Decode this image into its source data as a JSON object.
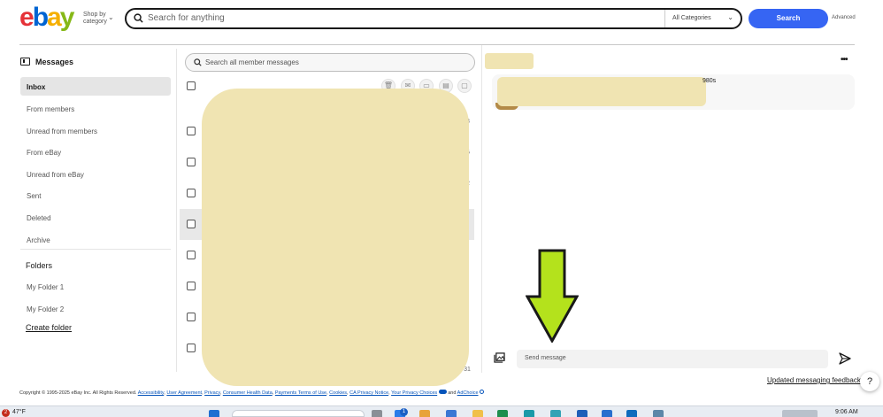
{
  "header": {
    "logo": {
      "e": "e",
      "b": "b",
      "a": "a",
      "y": "y"
    },
    "shop_by_line1": "Shop by",
    "shop_by_line2": "category",
    "search_placeholder": "Search for anything",
    "category_select": "All Categories",
    "search_button": "Search",
    "advanced": "Advanced"
  },
  "sidebar": {
    "title": "Messages",
    "items": [
      {
        "label": "Inbox",
        "active": true
      },
      {
        "label": "From members"
      },
      {
        "label": "Unread from members"
      },
      {
        "label": "From eBay"
      },
      {
        "label": "Unread from eBay"
      },
      {
        "label": "Sent"
      },
      {
        "label": "Deleted"
      },
      {
        "label": "Archive"
      }
    ],
    "folders_heading": "Folders",
    "folders": [
      {
        "label": "My Folder 1"
      },
      {
        "label": "My Folder 2"
      }
    ],
    "create_folder": "Create folder"
  },
  "message_list": {
    "search_placeholder": "Search all member messages",
    "date_fragments": [
      "3",
      "6",
      "2",
      "ar 31"
    ]
  },
  "conversation": {
    "item_title_fragment": "980s",
    "compose_placeholder": "Send message"
  },
  "footer": {
    "copyright": "Copyright © 1995-2025 eBay Inc. All Rights Reserved.",
    "links": [
      "Accessibility",
      "User Agreement",
      "Privacy",
      "Consumer Health Data",
      "Payments Terms of Use",
      "Cookies",
      "CA Privacy Notice",
      "Your Privacy Choices"
    ],
    "and": "and",
    "adchoice": "AdChoice",
    "feedback": "Updated messaging feedback",
    "help": "?"
  },
  "taskbar": {
    "notification_count": "2",
    "weather": "47°F",
    "badge_count": "1",
    "time": "9:06 AM"
  },
  "colors": {
    "accent": "#3665f3",
    "redaction": "#f0e4b2",
    "arrow": "#b4e21c"
  }
}
